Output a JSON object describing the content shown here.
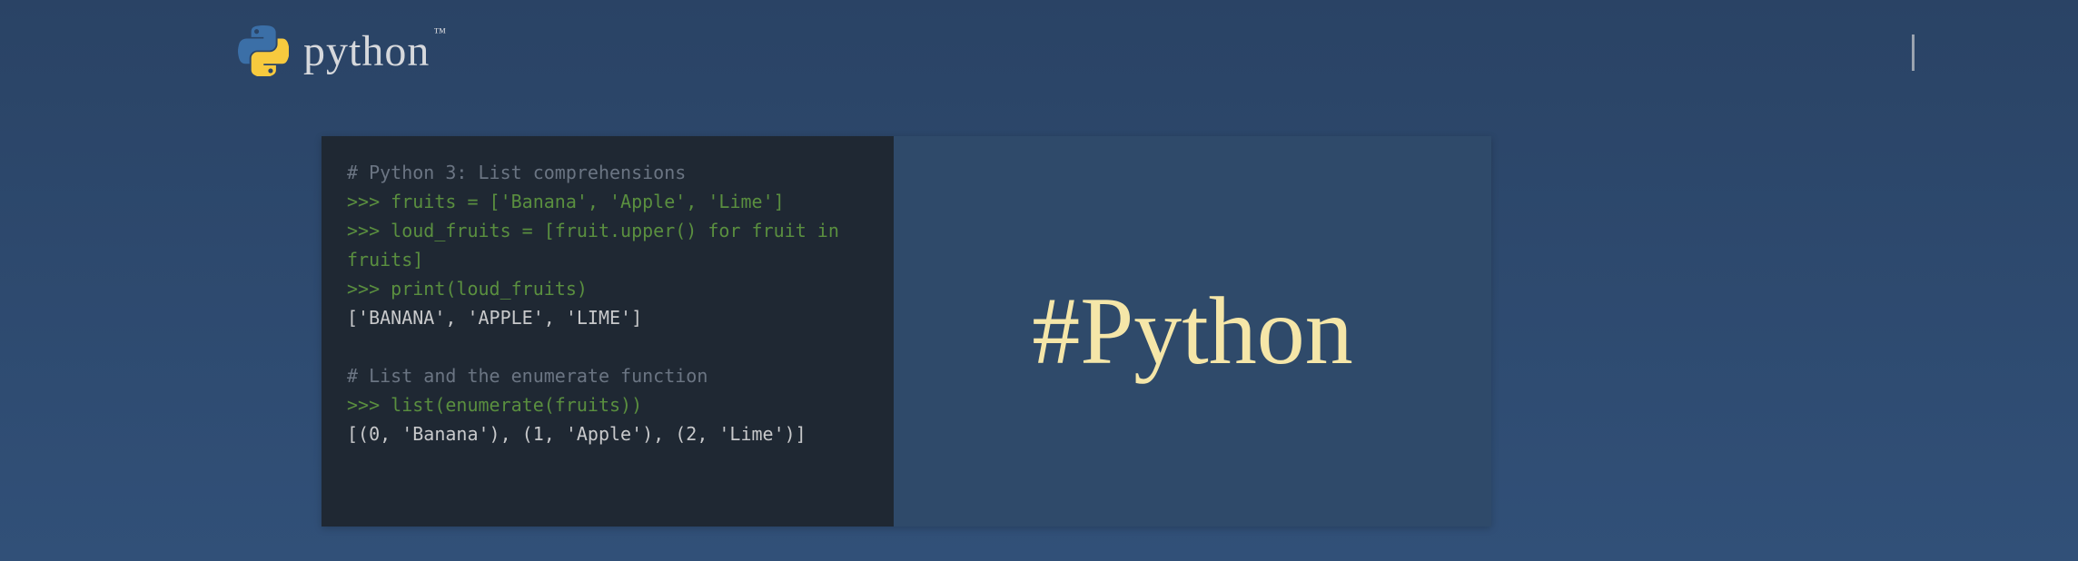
{
  "logo": {
    "text": "python",
    "trademark": "™"
  },
  "code": {
    "line1_comment": "# Python 3: List comprehensions",
    "line2_prompt": ">>> ",
    "line2_code": "fruits = ['Banana', 'Apple', 'Lime']",
    "line3_prompt": ">>> ",
    "line3_code": "loud_fruits = [fruit.upper() for fruit in",
    "line4_code": "fruits]",
    "line5_prompt": ">>> ",
    "line5_code": "print(loud_fruits)",
    "line6_output": "['BANANA', 'APPLE', 'LIME']",
    "line7_blank": "",
    "line8_comment": "# List and the enumerate function",
    "line9_prompt": ">>> ",
    "line9_code": "list(enumerate(fruits))",
    "line10_output": "[(0, 'Banana'), (1, 'Apple'), (2, 'Lime')]"
  },
  "hashtag": "#Python"
}
